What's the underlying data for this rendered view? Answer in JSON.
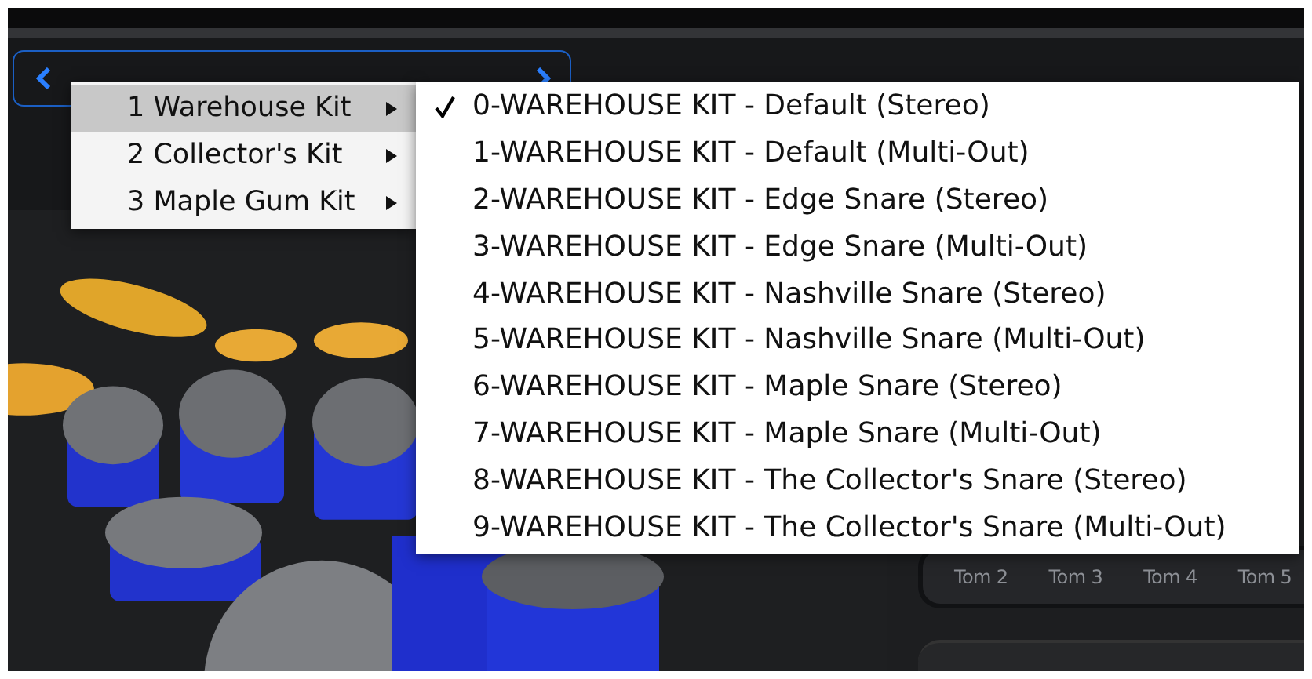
{
  "kit_menu": [
    {
      "label": "1 Warehouse Kit",
      "selected": true
    },
    {
      "label": "2 Collector's Kit",
      "selected": false
    },
    {
      "label": "3 Maple Gum Kit",
      "selected": false
    }
  ],
  "preset_menu": [
    {
      "label": "0-WAREHOUSE KIT - Default (Stereo)",
      "checked": true
    },
    {
      "label": "1-WAREHOUSE KIT - Default (Multi-Out)",
      "checked": false
    },
    {
      "label": "2-WAREHOUSE KIT - Edge Snare (Stereo)",
      "checked": false
    },
    {
      "label": "3-WAREHOUSE KIT - Edge Snare (Multi-Out)",
      "checked": false
    },
    {
      "label": "4-WAREHOUSE KIT - Nashville Snare (Stereo)",
      "checked": false
    },
    {
      "label": "5-WAREHOUSE KIT - Nashville Snare (Multi-Out)",
      "checked": false
    },
    {
      "label": "6-WAREHOUSE KIT - Maple Snare (Stereo)",
      "checked": false
    },
    {
      "label": "7-WAREHOUSE KIT - Maple Snare (Multi-Out)",
      "checked": false
    },
    {
      "label": "8-WAREHOUSE KIT - The Collector's Snare (Stereo)",
      "checked": false
    },
    {
      "label": "9-WAREHOUSE KIT - The Collector's Snare (Multi-Out)",
      "checked": false
    }
  ],
  "output_labels": [
    "Tom 2",
    "Tom 3",
    "Tom 4",
    "Tom 5"
  ]
}
